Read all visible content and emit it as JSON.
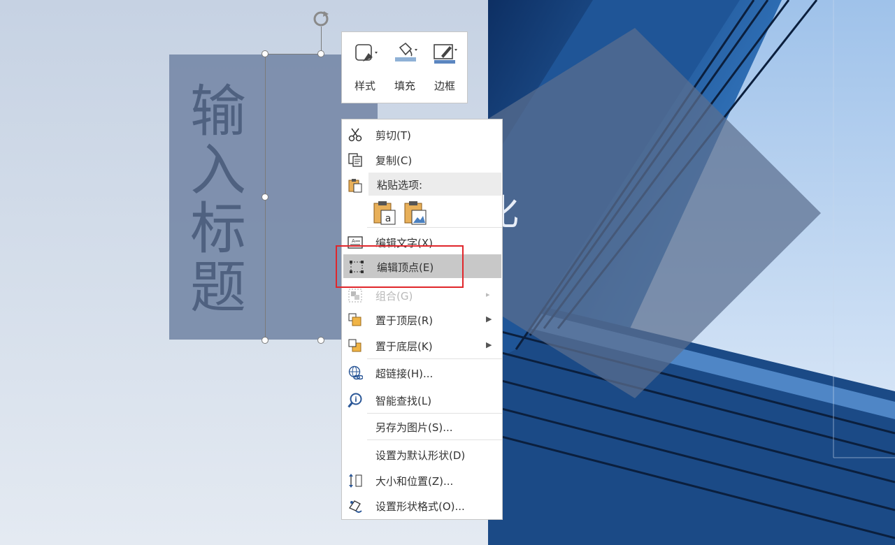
{
  "slide": {
    "title_text": "输入标题",
    "overlay_text": "化"
  },
  "mini_toolbar": {
    "buttons": [
      {
        "label": "样式",
        "icon": "shape-style-icon"
      },
      {
        "label": "填充",
        "icon": "fill-bucket-icon"
      },
      {
        "label": "边框",
        "icon": "outline-pen-icon"
      }
    ]
  },
  "context_menu": {
    "cut": "剪切(T)",
    "copy": "复制(C)",
    "paste_options_header": "粘贴选项:",
    "edit_text": "编辑文字(X)",
    "edit_points": "编辑顶点(E)",
    "group": "组合(G)",
    "bring_to_front": "置于顶层(R)",
    "send_to_back": "置于底层(K)",
    "hyperlink": "超链接(H)...",
    "smart_lookup": "智能查找(L)",
    "save_as_picture": "另存为图片(S)...",
    "set_default_shape": "设置为默认形状(D)",
    "size_position": "大小和位置(Z)...",
    "format_shape": "设置形状格式(O)..."
  },
  "colors": {
    "highlight_border": "#e0262b",
    "hover_bg": "#c8c8c8",
    "shape_fill": "#7a8cab"
  }
}
